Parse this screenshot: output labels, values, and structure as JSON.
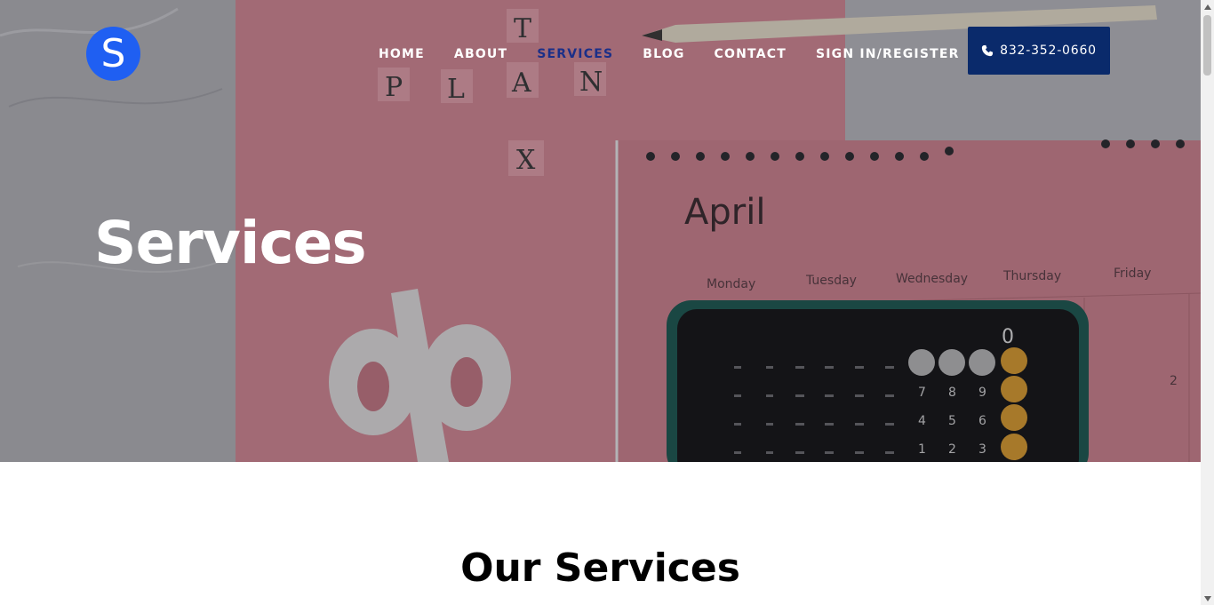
{
  "header": {
    "logo_letter": "S",
    "nav": [
      {
        "label": "HOME",
        "active": false
      },
      {
        "label": "ABOUT",
        "active": false
      },
      {
        "label": "SERVICES",
        "active": true
      },
      {
        "label": "BLOG",
        "active": false
      },
      {
        "label": "CONTACT",
        "active": false
      },
      {
        "label": "SIGN IN/REGISTER",
        "active": false
      }
    ],
    "phone": {
      "icon": "phone-icon",
      "label": "832-352-0660"
    }
  },
  "hero": {
    "title": "Services",
    "photo": {
      "scrabble_letters": [
        "T",
        "P",
        "L",
        "A",
        "N",
        "X"
      ],
      "calendar_month": "April",
      "weekdays": [
        "Monday",
        "Tuesday",
        "Wednesday",
        "Thursday",
        "Friday"
      ],
      "calendar_day": "2",
      "calculator_display": "0",
      "calculator_keys": [
        "7",
        "8",
        "9",
        "4",
        "5",
        "6",
        "1",
        "2",
        "3"
      ]
    }
  },
  "main": {
    "section_title": "Our Services"
  },
  "colors": {
    "accent_blue": "#1f5ff2",
    "button_navy": "#0a2a6b",
    "active_nav": "#1b2f88",
    "pink": "#d98b98"
  }
}
